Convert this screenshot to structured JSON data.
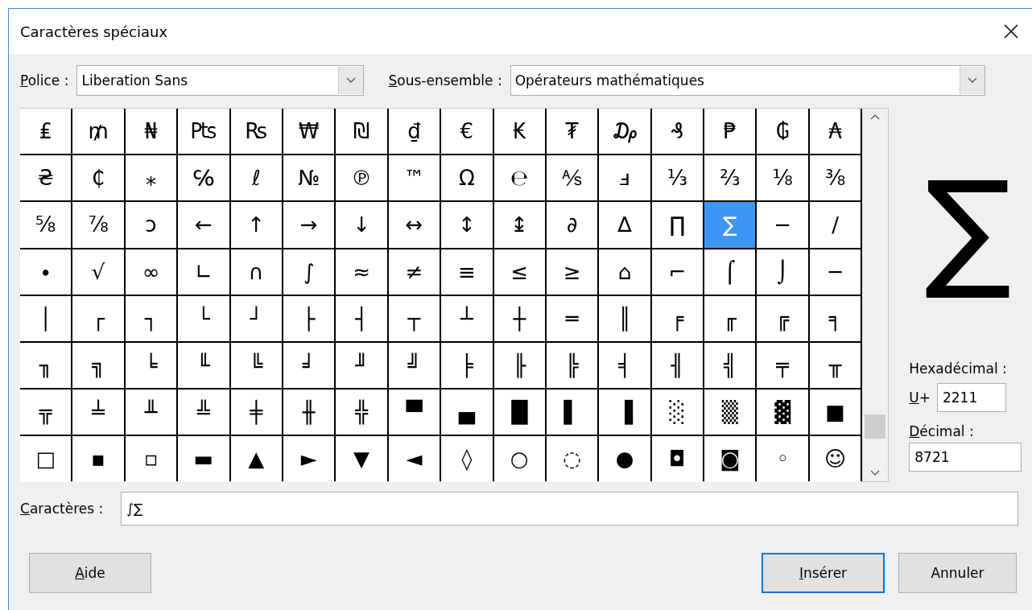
{
  "window": {
    "title": "Caractères spéciaux"
  },
  "font": {
    "label": "Police :",
    "mnemonic": true,
    "value": "Liberation Sans"
  },
  "subset": {
    "label": "Sous-ensemble :",
    "mnemonic": true,
    "value": "Opérateurs mathématiques"
  },
  "grid": [
    [
      {
        "char": "₤",
        "selected": false
      },
      {
        "char": "₥",
        "selected": false
      },
      {
        "char": "₦",
        "selected": false
      },
      {
        "char": "₧",
        "selected": false
      },
      {
        "char": "₨",
        "selected": false
      },
      {
        "char": "₩",
        "selected": false
      },
      {
        "char": "₪",
        "selected": false
      },
      {
        "char": "₫",
        "selected": false
      },
      {
        "char": "€",
        "selected": false
      },
      {
        "char": "₭",
        "selected": false
      },
      {
        "char": "₮",
        "selected": false
      },
      {
        "char": "₯",
        "selected": false
      },
      {
        "char": "₰",
        "selected": false
      },
      {
        "char": "₱",
        "selected": false
      },
      {
        "char": "₲",
        "selected": false
      },
      {
        "char": "₳",
        "selected": false
      }
    ],
    [
      {
        "char": "₴",
        "selected": false
      },
      {
        "char": "₵",
        "selected": false
      },
      {
        "char": "⁎",
        "selected": false
      },
      {
        "char": "℅",
        "selected": false
      },
      {
        "char": "ℓ",
        "selected": false
      },
      {
        "char": "№",
        "selected": false
      },
      {
        "char": "℗",
        "selected": false
      },
      {
        "char": "™",
        "selected": false
      },
      {
        "char": "Ω",
        "selected": false
      },
      {
        "char": "℮",
        "selected": false
      },
      {
        "char": "⅍",
        "selected": false
      },
      {
        "char": "ⅎ",
        "selected": false
      },
      {
        "char": "⅓",
        "selected": false
      },
      {
        "char": "⅔",
        "selected": false
      },
      {
        "char": "⅛",
        "selected": false
      },
      {
        "char": "⅜",
        "selected": false
      }
    ],
    [
      {
        "char": "⅝",
        "selected": false
      },
      {
        "char": "⅞",
        "selected": false
      },
      {
        "char": "ↄ",
        "selected": false
      },
      {
        "char": "←",
        "selected": false
      },
      {
        "char": "↑",
        "selected": false
      },
      {
        "char": "→",
        "selected": false
      },
      {
        "char": "↓",
        "selected": false
      },
      {
        "char": "↔",
        "selected": false
      },
      {
        "char": "↕",
        "selected": false
      },
      {
        "char": "↨",
        "selected": false
      },
      {
        "char": "∂",
        "selected": false
      },
      {
        "char": "∆",
        "selected": false
      },
      {
        "char": "∏",
        "selected": false
      },
      {
        "char": "∑",
        "selected": true
      },
      {
        "char": "−",
        "selected": false
      },
      {
        "char": "∕",
        "selected": false
      }
    ],
    [
      {
        "char": "∙",
        "selected": false
      },
      {
        "char": "√",
        "selected": false
      },
      {
        "char": "∞",
        "selected": false
      },
      {
        "char": "∟",
        "selected": false
      },
      {
        "char": "∩",
        "selected": false
      },
      {
        "char": "∫",
        "selected": false
      },
      {
        "char": "≈",
        "selected": false
      },
      {
        "char": "≠",
        "selected": false
      },
      {
        "char": "≡",
        "selected": false
      },
      {
        "char": "≤",
        "selected": false
      },
      {
        "char": "≥",
        "selected": false
      },
      {
        "char": "⌂",
        "selected": false
      },
      {
        "char": "⌐",
        "selected": false
      },
      {
        "char": "⌠",
        "selected": false
      },
      {
        "char": "⌡",
        "selected": false
      },
      {
        "char": "─",
        "selected": false
      }
    ],
    [
      {
        "char": "│",
        "selected": false
      },
      {
        "char": "┌",
        "selected": false
      },
      {
        "char": "┐",
        "selected": false
      },
      {
        "char": "└",
        "selected": false
      },
      {
        "char": "┘",
        "selected": false
      },
      {
        "char": "├",
        "selected": false
      },
      {
        "char": "┤",
        "selected": false
      },
      {
        "char": "┬",
        "selected": false
      },
      {
        "char": "┴",
        "selected": false
      },
      {
        "char": "┼",
        "selected": false
      },
      {
        "char": "═",
        "selected": false
      },
      {
        "char": "║",
        "selected": false
      },
      {
        "char": "╒",
        "selected": false
      },
      {
        "char": "╓",
        "selected": false
      },
      {
        "char": "╔",
        "selected": false
      },
      {
        "char": "╕",
        "selected": false
      }
    ],
    [
      {
        "char": "╖",
        "selected": false
      },
      {
        "char": "╗",
        "selected": false
      },
      {
        "char": "╘",
        "selected": false
      },
      {
        "char": "╙",
        "selected": false
      },
      {
        "char": "╚",
        "selected": false
      },
      {
        "char": "╛",
        "selected": false
      },
      {
        "char": "╜",
        "selected": false
      },
      {
        "char": "╝",
        "selected": false
      },
      {
        "char": "╞",
        "selected": false
      },
      {
        "char": "╟",
        "selected": false
      },
      {
        "char": "╠",
        "selected": false
      },
      {
        "char": "╡",
        "selected": false
      },
      {
        "char": "╢",
        "selected": false
      },
      {
        "char": "╣",
        "selected": false
      },
      {
        "char": "╤",
        "selected": false
      },
      {
        "char": "╥",
        "selected": false
      }
    ],
    [
      {
        "char": "╦",
        "selected": false
      },
      {
        "char": "╧",
        "selected": false
      },
      {
        "char": "╨",
        "selected": false
      },
      {
        "char": "╩",
        "selected": false
      },
      {
        "char": "╪",
        "selected": false
      },
      {
        "char": "╫",
        "selected": false
      },
      {
        "char": "╬",
        "selected": false
      },
      {
        "char": "▀",
        "selected": false
      },
      {
        "char": "▄",
        "selected": false
      },
      {
        "char": "█",
        "selected": false
      },
      {
        "char": "▌",
        "selected": false
      },
      {
        "char": "▐",
        "selected": false
      },
      {
        "char": "░",
        "selected": false
      },
      {
        "char": "▒",
        "selected": false
      },
      {
        "char": "▓",
        "selected": false
      },
      {
        "char": "■",
        "selected": false
      }
    ],
    [
      {
        "char": "□",
        "selected": false
      },
      {
        "char": "▪",
        "selected": false
      },
      {
        "char": "▫",
        "selected": false
      },
      {
        "char": "▬",
        "selected": false
      },
      {
        "char": "▲",
        "selected": false
      },
      {
        "char": "►",
        "selected": false
      },
      {
        "char": "▼",
        "selected": false
      },
      {
        "char": "◄",
        "selected": false
      },
      {
        "char": "◊",
        "selected": false
      },
      {
        "char": "○",
        "selected": false
      },
      {
        "char": "◌",
        "selected": false
      },
      {
        "char": "●",
        "selected": false
      },
      {
        "char": "◘",
        "selected": false
      },
      {
        "char": "◙",
        "selected": false
      },
      {
        "char": "◦",
        "selected": false
      },
      {
        "char": "☺",
        "selected": false
      }
    ]
  ],
  "preview": "∑",
  "hex": {
    "label": "Hexadécimal :",
    "prefix": "U+",
    "prefix_mnemonic": true,
    "value": "2211"
  },
  "decimal": {
    "label": "Décimal :",
    "mnemonic": true,
    "value": "8721"
  },
  "characters": {
    "label": "Caractères :",
    "mnemonic": true,
    "value": "∫∑"
  },
  "buttons": [
    {
      "label": "Aide",
      "mnemonic": true,
      "default": false
    },
    {
      "label": "Insérer",
      "mnemonic": true,
      "default": true
    },
    {
      "label": "Annuler",
      "mnemonic": false,
      "default": false
    }
  ]
}
